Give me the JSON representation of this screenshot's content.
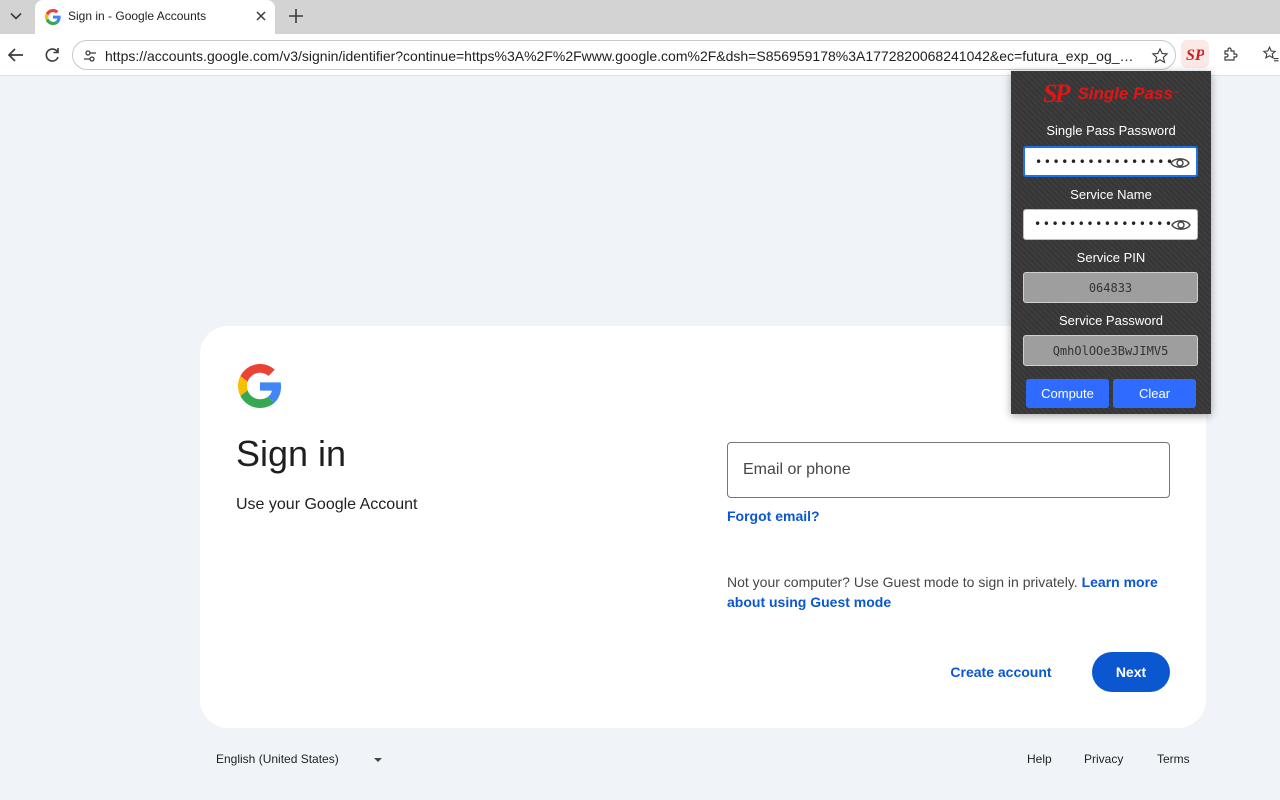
{
  "browser": {
    "tab": {
      "title": "Sign in - Google Accounts",
      "favicon": "google-g-icon"
    },
    "url": "https://accounts.google.com/v3/signin/identifier?continue=https%3A%2F%2Fwww.google.com%2F&dsh=S856959178%3A1772820068241042&ec=futura_exp_og_so..."
  },
  "signin": {
    "title": "Sign in",
    "subtitle": "Use your Google Account",
    "email_placeholder": "Email or phone",
    "forgot_email": "Forgot email?",
    "guest_text": "Not your computer? Use Guest mode to sign in privately. ",
    "learn_more": "Learn more about using Guest mode",
    "create_account": "Create account",
    "next": "Next"
  },
  "footer": {
    "language": "English (United States)",
    "help": "Help",
    "privacy": "Privacy",
    "terms": "Terms"
  },
  "singlepass": {
    "logo": "SP",
    "brand": "Single Pass",
    "tm": "™",
    "labels": {
      "master_password": "Single Pass Password",
      "service_name": "Service Name",
      "service_pin": "Service PIN",
      "service_password": "Service Password"
    },
    "master_password_mask": "••••••••••••••••",
    "service_name_mask": "••••••••••••••••",
    "service_pin": "064833",
    "service_password": "QmhOlOOe3BwJIMV5",
    "compute": "Compute",
    "clear": "Clear",
    "colors": {
      "brand_red": "#e01515",
      "button_blue": "#2f6bff"
    }
  }
}
